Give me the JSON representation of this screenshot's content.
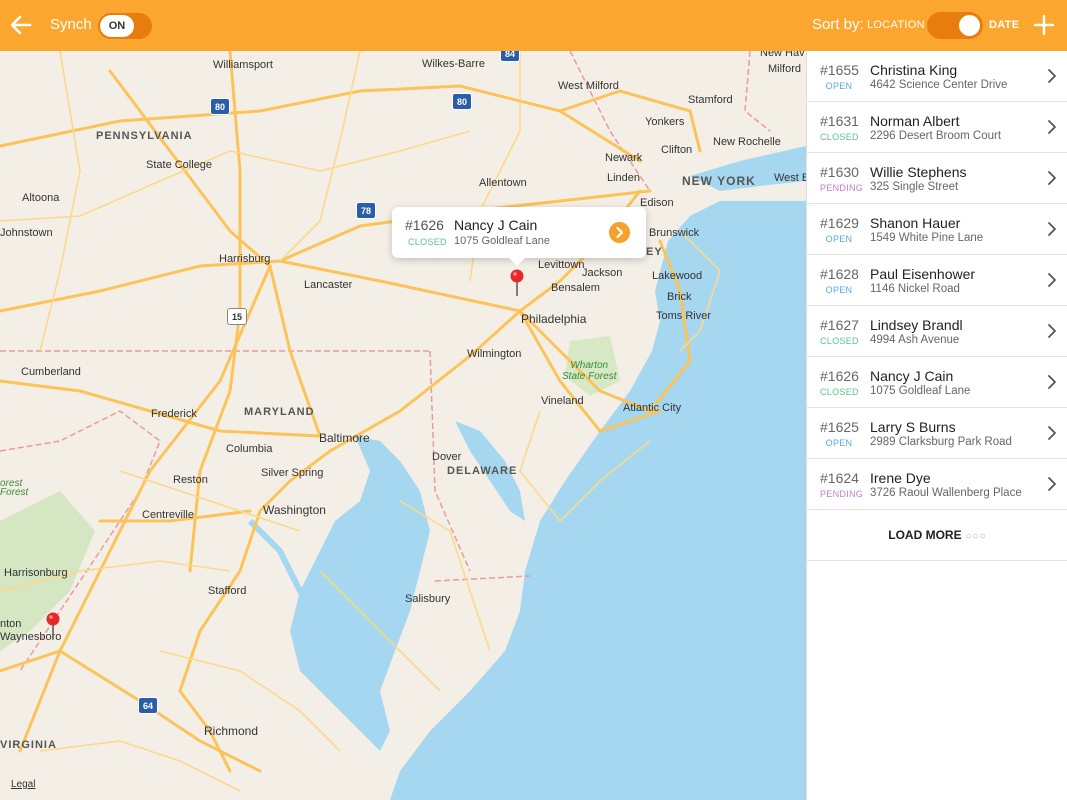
{
  "header": {
    "synch_label": "Synch",
    "synch_state": "ON",
    "sort_label": "Sort by:",
    "sort_location": "LOCATION",
    "sort_date": "DATE",
    "sort_selected": "DATE"
  },
  "colors": {
    "accent": "#fba62f",
    "accent_dark": "#e87d0d",
    "open": "#5aa8e0",
    "closed": "#5cc38c",
    "pending": "#c77bd0"
  },
  "map": {
    "labels": {
      "williamsport": "Williamsport",
      "wilkes_barre": "Wilkes-Barre",
      "pennsylvania": "PENNSYLVANIA",
      "state_college": "State College",
      "altoona": "Altoona",
      "johnstown": "Johnstown",
      "harrisburg": "Harrisburg",
      "lancaster": "Lancaster",
      "allentown": "Allentown",
      "cumberland": "Cumberland",
      "frederick": "Frederick",
      "maryland": "MARYLAND",
      "baltimore": "Baltimore",
      "columbia": "Columbia",
      "silver_spring": "Silver Spring",
      "reston": "Reston",
      "washington": "Washington",
      "centreville": "Centreville",
      "harrisonburg": "Harrisonburg",
      "stafford": "Stafford",
      "waynesboro": "Waynesboro",
      "nton": "nton",
      "virginia": "VIRGINIA",
      "richmond": "Richmond",
      "dover": "Dover",
      "delaware": "DELAWARE",
      "salisbury": "Salisbury",
      "wilmington": "Wilmington",
      "philadelphia": "Philadelphia",
      "vineland": "Vineland",
      "atlantic_city": "Atlantic City",
      "wharton": "Wharton\nState Forest",
      "toms_river": "Toms River",
      "brick": "Brick",
      "lakewood": "Lakewood",
      "jackson": "Jackson",
      "bensalem": "Bensalem",
      "levittown": "Levittown",
      "brunswick": "Brunswick",
      "new_york": "NEW YORK",
      "newark": "Newark",
      "clifton": "Clifton",
      "linden": "Linden",
      "yonkers": "Yonkers",
      "new_rochelle": "New Rochelle",
      "stamford": "Stamford",
      "west_milford": "West Milford",
      "new_haven": "New Hav",
      "milford": "Milford",
      "west_b": "West B",
      "edison": "Edison",
      "ey": "EY",
      "forest": "orest",
      "forest_f": "Forest"
    },
    "highways": {
      "i80a": "80",
      "i80b": "80",
      "i84": "84",
      "i78": "78",
      "us15": "15",
      "i64": "64"
    },
    "legal": "Legal"
  },
  "callout": {
    "number": "#1626",
    "status": "CLOSED",
    "name": "Nancy J Cain",
    "address": "1075 Goldleaf Lane"
  },
  "tickets": [
    {
      "number": "#1655",
      "status": "OPEN",
      "name": "Christina King",
      "address": "4642 Science Center Drive"
    },
    {
      "number": "#1631",
      "status": "CLOSED",
      "name": "Norman Albert",
      "address": "2296 Desert Broom Court"
    },
    {
      "number": "#1630",
      "status": "PENDING",
      "name": "Willie Stephens",
      "address": "325 Single Street"
    },
    {
      "number": "#1629",
      "status": "OPEN",
      "name": "Shanon Hauer",
      "address": "1549 White Pine Lane"
    },
    {
      "number": "#1628",
      "status": "OPEN",
      "name": "Paul Eisenhower",
      "address": "1146 Nickel Road"
    },
    {
      "number": "#1627",
      "status": "CLOSED",
      "name": "Lindsey Brandl",
      "address": "4994 Ash Avenue"
    },
    {
      "number": "#1626",
      "status": "CLOSED",
      "name": "Nancy J Cain",
      "address": "1075 Goldleaf Lane"
    },
    {
      "number": "#1625",
      "status": "OPEN",
      "name": "Larry S Burns",
      "address": "2989 Clarksburg Park Road"
    },
    {
      "number": "#1624",
      "status": "PENDING",
      "name": "Irene Dye",
      "address": "3726 Raoul Wallenberg Place"
    }
  ],
  "load_more": {
    "label": "LOAD MORE",
    "dots": "○○○"
  }
}
